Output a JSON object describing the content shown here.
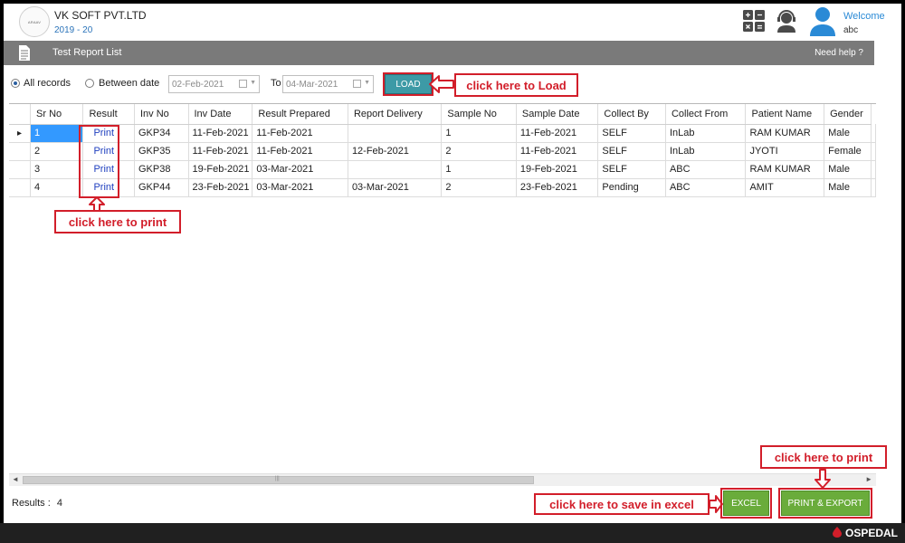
{
  "header": {
    "logo_text": "ARAAV",
    "company": "VK SOFT PVT.LTD",
    "year": "2019 - 20",
    "welcome": "Welcome",
    "user": "abc"
  },
  "titlebar": {
    "title": "Test Report List",
    "help": "Need help ?"
  },
  "filters": {
    "all_records": "All records",
    "between_date": "Between date",
    "selected": "All records",
    "from_date": "02-Feb-2021",
    "to_label": "To",
    "to_date": "04-Mar-2021",
    "load": "LOAD"
  },
  "annotations": {
    "load": "click here to Load",
    "print_column": "click here to print",
    "print_button": "click here to print",
    "excel": "click here to save in excel"
  },
  "grid": {
    "columns": [
      "Sr No",
      "Result",
      "Inv No",
      "Inv Date",
      "Result Prepared",
      "Report Delivery",
      "Sample No",
      "Sample Date",
      "Collect By",
      "Collect From",
      "Patient Name",
      "Gender"
    ],
    "rows": [
      [
        "1",
        "Print",
        "GKP34",
        "11-Feb-2021",
        "11-Feb-2021",
        "",
        "1",
        "11-Feb-2021",
        "SELF",
        "InLab",
        "RAM KUMAR",
        "Male"
      ],
      [
        "2",
        "Print",
        "GKP35",
        "11-Feb-2021",
        "11-Feb-2021",
        "12-Feb-2021",
        "2",
        "11-Feb-2021",
        "SELF",
        "InLab",
        "JYOTI",
        "Female"
      ],
      [
        "3",
        "Print",
        "GKP38",
        "19-Feb-2021",
        "03-Mar-2021",
        "",
        "1",
        "19-Feb-2021",
        "SELF",
        "ABC",
        "RAM KUMAR",
        "Male"
      ],
      [
        "4",
        "Print",
        "GKP44",
        "23-Feb-2021",
        "03-Mar-2021",
        "03-Mar-2021",
        "2",
        "23-Feb-2021",
        "Pending",
        "ABC",
        "AMIT",
        "Male"
      ]
    ],
    "selected_row": 0
  },
  "footer": {
    "results_label": "Results :",
    "results_count": "4",
    "excel": "EXCEL",
    "print_export": "PRINT & EXPORT",
    "brand": "OSPEDAL"
  },
  "colors": {
    "accent_blue": "#2a73b9",
    "load_button": "#3d9aa6",
    "green_button": "#6aac3b",
    "annotation_red": "#d21e2a",
    "selection": "#3399ff"
  },
  "icons": {
    "calculator": "calculator-icon",
    "support": "support-agent-icon",
    "user": "user-avatar-icon",
    "document": "document-icon",
    "calendar": "calendar-icon"
  }
}
